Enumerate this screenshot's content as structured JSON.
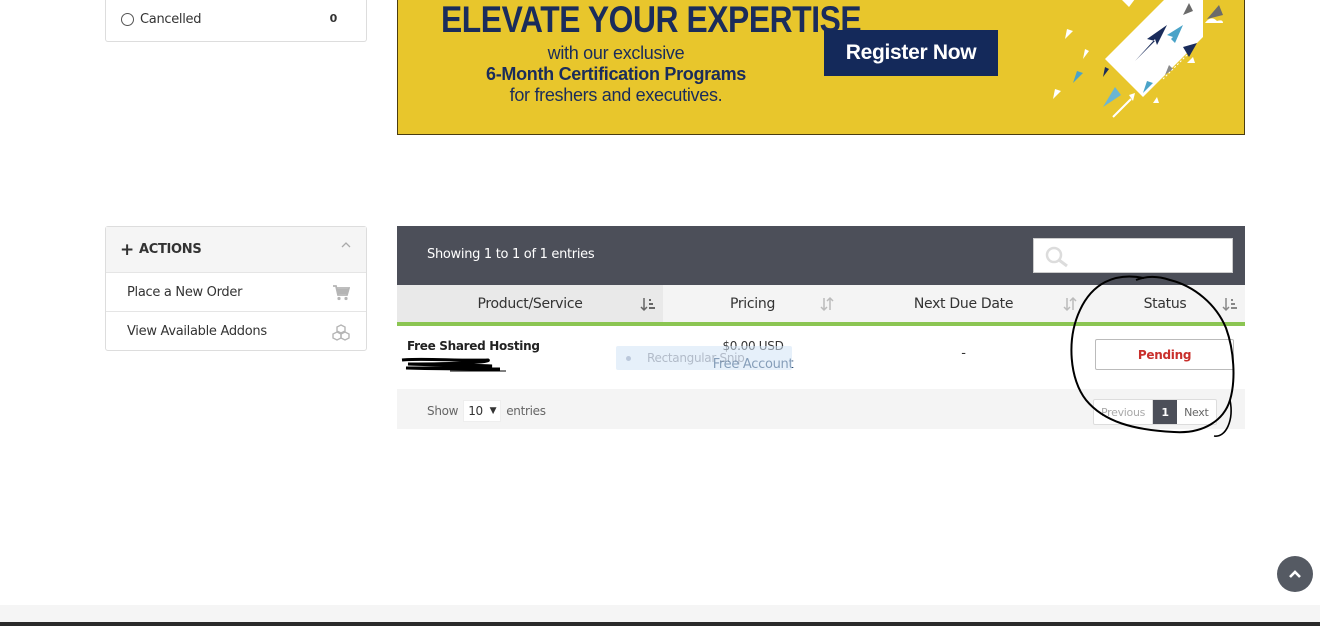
{
  "status_filter": {
    "label": "Cancelled",
    "count": "0"
  },
  "banner": {
    "headline": "ELEVATE YOUR EXPERTISE",
    "line1": "with our exclusive",
    "line2": "6-Month Certification Programs",
    "line3": "for freshers and executives.",
    "button": "Register Now"
  },
  "actions": {
    "title": "ACTIONS",
    "items": [
      {
        "label": "Place a New Order",
        "icon": "cart-icon"
      },
      {
        "label": "View Available Addons",
        "icon": "cubes-icon"
      }
    ]
  },
  "table": {
    "info": "Showing 1 to 1 of 1 entries",
    "columns": [
      "Product/Service",
      "Pricing",
      "Next Due Date",
      "Status"
    ],
    "rows": [
      {
        "product": "Free Shared Hosting",
        "price": "$0.00 USD",
        "price_sub": "Free Account",
        "due": "-",
        "status": "Pending"
      }
    ],
    "length": {
      "prefix": "Show",
      "value": "10",
      "suffix": "entries"
    },
    "pagination": {
      "prev": "Previous",
      "current": "1",
      "next": "Next"
    }
  },
  "tooltip": "Rectangular Snip",
  "colors": {
    "header_bg": "#4c4f59",
    "accent_green": "#8bc552",
    "status_pending": "#c9302c",
    "banner_bg": "#e8c62c",
    "banner_navy": "#14295a"
  }
}
